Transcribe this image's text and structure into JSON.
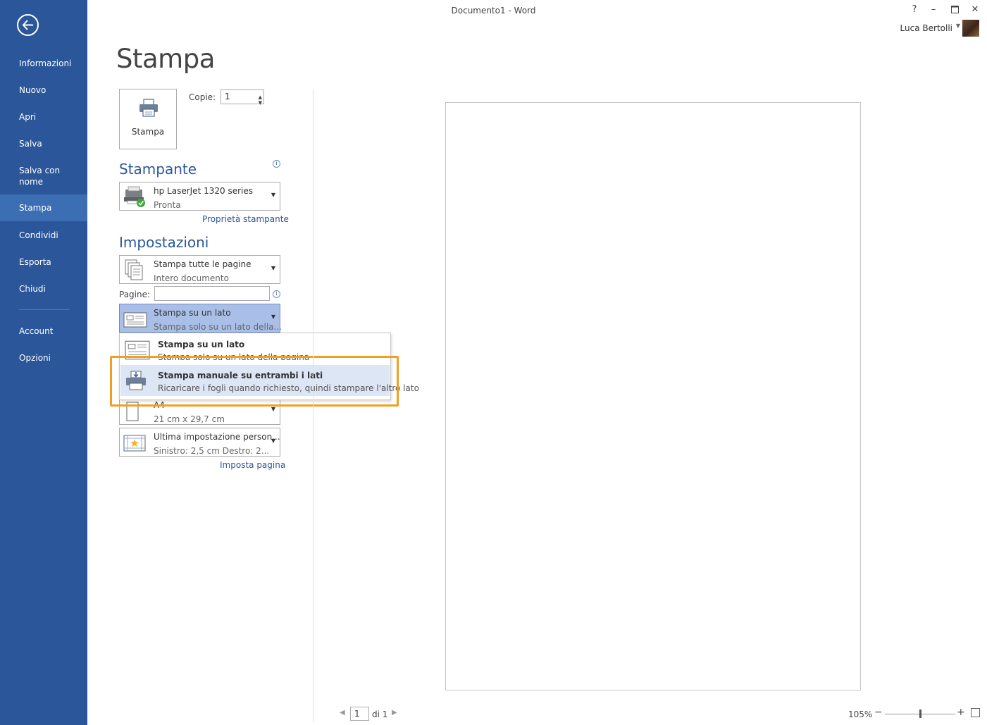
{
  "window": {
    "title": "Documento1 - Word",
    "help": "?",
    "minimize": "–",
    "maximize": "▫",
    "close": "✕",
    "user_name": "Luca Bertolli"
  },
  "sidebar": {
    "back_icon": "back-arrow-icon",
    "items": [
      {
        "label": "Informazioni"
      },
      {
        "label": "Nuovo"
      },
      {
        "label": "Apri"
      },
      {
        "label": "Salva"
      },
      {
        "label": "Salva con nome"
      },
      {
        "label": "Stampa",
        "active": true
      },
      {
        "label": "Condividi"
      },
      {
        "label": "Esporta"
      },
      {
        "label": "Chiudi"
      },
      {
        "label": "Account"
      },
      {
        "label": "Opzioni"
      }
    ]
  },
  "print": {
    "page_title": "Stampa",
    "print_button": "Stampa",
    "copies_label": "Copie:",
    "copies_value": "1"
  },
  "printer": {
    "heading": "Stampante",
    "name": "hp LaserJet 1320 series",
    "status": "Pronta",
    "properties_link": "Proprietà stampante"
  },
  "settings": {
    "heading": "Impostazioni",
    "range": {
      "title": "Stampa tutte le pagine",
      "desc": "Intero documento"
    },
    "pages_label": "Pagine:",
    "pages_value": "",
    "sides": {
      "title": "Stampa su un lato",
      "desc": "Stampa solo su un lato della..."
    },
    "paper": {
      "title": "A4",
      "desc": "21 cm x 29,7 cm"
    },
    "margins": {
      "title": "Ultima impostazione person...",
      "desc": "Sinistro:  2,5 cm    Destro:  2..."
    },
    "page_setup_link": "Imposta pagina"
  },
  "sides_menu": {
    "items": [
      {
        "title": "Stampa su un lato",
        "desc": "Stampa solo su un lato della pagina"
      },
      {
        "title": "Stampa manuale su entrambi i lati",
        "desc": "Ricaricare i fogli quando richiesto, quindi stampare l'altro lato"
      }
    ]
  },
  "preview": {
    "page_current": "1",
    "page_of": "di 1",
    "zoom": "105%",
    "zoom_minus": "−",
    "zoom_plus": "+"
  },
  "colors": {
    "accent": "#2b579a",
    "sidebar_active": "#3c6eb4",
    "selected_dropdown": "#a9bfe8",
    "callout": "#f0a020"
  }
}
